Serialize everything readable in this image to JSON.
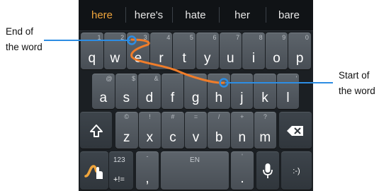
{
  "suggestions": [
    "here",
    "here's",
    "hate",
    "her",
    "bare"
  ],
  "colors": {
    "suggestion_active": "#f0a53c",
    "trace": "#f07d2a",
    "marker": "#2d8de3"
  },
  "rows": {
    "r1": [
      {
        "k": "q",
        "h": "1"
      },
      {
        "k": "w",
        "h": "2"
      },
      {
        "k": "e",
        "h": "3"
      },
      {
        "k": "r",
        "h": "4"
      },
      {
        "k": "t",
        "h": "5"
      },
      {
        "k": "y",
        "h": "6"
      },
      {
        "k": "u",
        "h": "7"
      },
      {
        "k": "i",
        "h": "8"
      },
      {
        "k": "o",
        "h": "9"
      },
      {
        "k": "p",
        "h": "0"
      }
    ],
    "r2": [
      {
        "k": "a",
        "h": "@"
      },
      {
        "k": "s",
        "h": "$"
      },
      {
        "k": "d",
        "h": "&"
      },
      {
        "k": "f",
        "h": ""
      },
      {
        "k": "g",
        "h": ""
      },
      {
        "k": "h",
        "h": ""
      },
      {
        "k": "j",
        "h": ""
      },
      {
        "k": "k",
        "h": ""
      },
      {
        "k": "l",
        "h": "'"
      }
    ],
    "r3": [
      {
        "k": "z",
        "h": "©"
      },
      {
        "k": "x",
        "h": "!"
      },
      {
        "k": "c",
        "h": "#"
      },
      {
        "k": "v",
        "h": "="
      },
      {
        "k": "b",
        "h": "/"
      },
      {
        "k": "n",
        "h": "+"
      },
      {
        "k": "m",
        "h": "?"
      }
    ]
  },
  "bottom": {
    "sym_top": "123",
    "sym_bottom": "+!=",
    "comma": ",",
    "comma_hint": "-",
    "space": "EN",
    "period": ".",
    "period_hint": "'",
    "emoticon": ":-)"
  },
  "icons": {
    "shift": "shift-icon",
    "backspace": "backspace-icon",
    "mic": "microphone-icon",
    "swype": "swype-icon"
  },
  "annotations": {
    "end_line1": "End of",
    "end_line2": "the word",
    "start_line1": "Start of",
    "start_line2": "the word"
  }
}
